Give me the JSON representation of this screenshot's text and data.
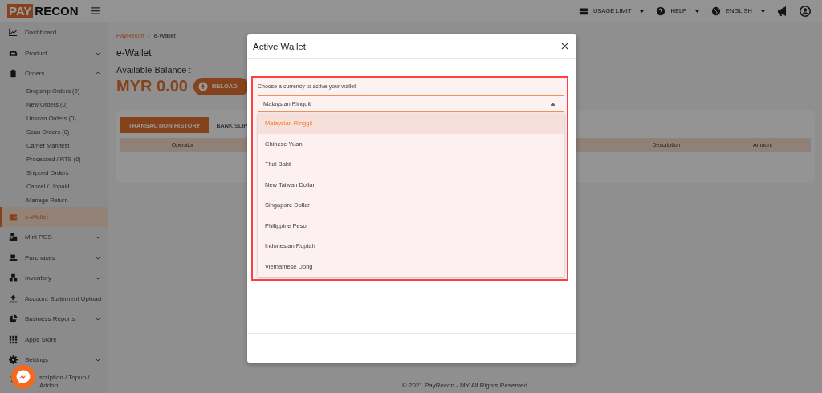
{
  "topbar": {
    "logo_left": "PAY",
    "logo_right": "RECON",
    "menus": [
      {
        "label": "USAGE LIMIT"
      },
      {
        "label": "HELP"
      },
      {
        "label": "ENGLISH"
      }
    ]
  },
  "sidebar": {
    "items": [
      {
        "label": "Dashboard",
        "kind": "link",
        "selected": false
      },
      {
        "label": "Product",
        "kind": "group",
        "expanded": false,
        "selected": false
      },
      {
        "label": "Orders",
        "kind": "group",
        "expanded": true,
        "selected": false,
        "children": [
          {
            "label": "Dropship Orders (0)",
            "selected": false
          },
          {
            "label": "New Orders (0)",
            "selected": false
          },
          {
            "label": "Unscan Orders (0)",
            "selected": false
          },
          {
            "label": "Scan Orders (0)",
            "selected": false
          },
          {
            "label": "Carrier Manifest",
            "selected": false
          },
          {
            "label": "Processed / RTS (0)",
            "selected": false
          },
          {
            "label": "Shipped Orders",
            "selected": false
          },
          {
            "label": "Cancel / Unpaid",
            "selected": false
          },
          {
            "label": "Manage Return",
            "selected": false
          }
        ]
      },
      {
        "label": "e-Wallet",
        "kind": "link",
        "selected": true
      },
      {
        "label": "Mini POS",
        "kind": "group",
        "expanded": false,
        "selected": false
      },
      {
        "label": "Purchases",
        "kind": "group",
        "expanded": false,
        "selected": false
      },
      {
        "label": "Inventory",
        "kind": "group",
        "expanded": false,
        "selected": false
      },
      {
        "label": "Account Statement Upload",
        "kind": "link",
        "selected": false
      },
      {
        "label": "Business Reports",
        "kind": "group",
        "expanded": false,
        "selected": false
      },
      {
        "label": "Apps Store",
        "kind": "link",
        "selected": false
      },
      {
        "label": "Settings",
        "kind": "group",
        "expanded": false,
        "selected": false
      },
      {
        "label": "scription / Topup / Addon",
        "kind": "link",
        "selected": false
      }
    ]
  },
  "breadcrumb": [
    {
      "label": "PayRecon",
      "kind": "link"
    },
    {
      "label": "/",
      "kind": "separator"
    },
    {
      "label": "e-Wallet",
      "kind": "current"
    }
  ],
  "page_title": "e-Wallet",
  "balance": {
    "label": "Available Balance :",
    "amount": "MYR 0.00",
    "reload_button": "RELOAD"
  },
  "tabs": [
    {
      "label": "TRANSACTION HISTORY",
      "selected": true
    },
    {
      "label": "BANK SLIP",
      "selected": false
    }
  ],
  "table": {
    "columns": [
      "Operator",
      "Description",
      "Amount"
    ]
  },
  "footer": "© 2021 PayRecon - MY All Rights Reserved.",
  "modal": {
    "title": "Active Wallet",
    "prompt": "Choose a currency to active your wallet",
    "select": {
      "value": "Malaysian Ringgit",
      "expanded": true
    },
    "options": [
      {
        "label": "Malaysian Ringgit",
        "selected": true
      },
      {
        "label": "Chinese Yuan",
        "selected": false
      },
      {
        "label": "Thai Baht",
        "selected": false
      },
      {
        "label": "New Taiwan Dollar",
        "selected": false
      },
      {
        "label": "Singapore Dollar",
        "selected": false
      },
      {
        "label": "Philippine Peso",
        "selected": false
      },
      {
        "label": "Indonesian Rupiah",
        "selected": false
      },
      {
        "label": "Vietnamese Dong",
        "selected": false
      }
    ]
  }
}
